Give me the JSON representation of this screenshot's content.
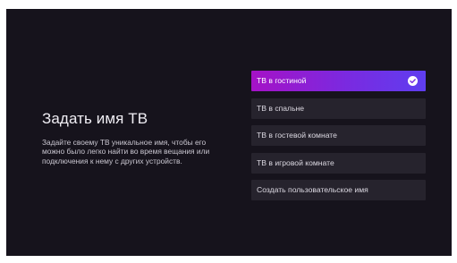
{
  "page": {
    "title": "Задать имя ТВ",
    "description": "Задайте своему ТВ уникальное имя, чтобы его можно было легко найти во время вещания или подключения к нему с других устройств."
  },
  "options": [
    {
      "label": "ТВ в гостиной",
      "selected": true
    },
    {
      "label": "ТВ в спальне",
      "selected": false
    },
    {
      "label": "ТВ в гостевой комнате",
      "selected": false
    },
    {
      "label": "ТВ в игровой комнате",
      "selected": false
    },
    {
      "label": "Создать пользовательское имя",
      "selected": false
    }
  ],
  "icons": {
    "selected_indicator": "checkmark-circle-icon"
  },
  "colors": {
    "background": "#16131c",
    "option_background": "#26232d",
    "selected_gradient_start": "#a512c6",
    "selected_gradient_end": "#5f3ef0"
  }
}
